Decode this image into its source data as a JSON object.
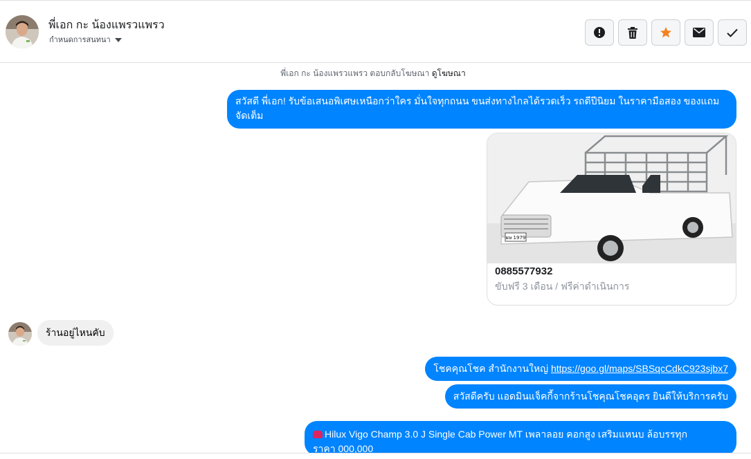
{
  "header": {
    "contact_name": "พี่เอก กะ น้องแพรวแพรว",
    "assign_label": "กำหนดการสนทนา",
    "actions": [
      {
        "name": "report-button",
        "icon": "alert-circle-icon"
      },
      {
        "name": "delete-button",
        "icon": "trash-icon"
      },
      {
        "name": "star-button",
        "icon": "star-icon"
      },
      {
        "name": "mark-unread-button",
        "icon": "envelope-icon"
      },
      {
        "name": "mark-done-button",
        "icon": "check-icon"
      }
    ]
  },
  "system_note": {
    "text": "พี่เอก กะ น้องแพรวแพรว ตอบกลับโฆษณา",
    "link": "ดูโฆษณา"
  },
  "messages": {
    "ad_reply": "สวัสดี พี่เอก! รับข้อเสนอพิเศษเหนือกว่าใคร มั่นใจทุกถนน ขนส่งทางไกลได้รวดเร็ว รถดีปีนิยม ในราคามือสอง ของแถมจัดเต็ม",
    "card": {
      "title": "0885577932",
      "subtitle": "ขับฟรี 3 เดือน / ฟรีค่าดำเนินการ",
      "plate": "ผษ 1979"
    },
    "customer_reply": "ร้านอยู่ไหนคับ",
    "location_prefix": "โชคคุณโชค สำนักงานใหญ่ ",
    "location_link": "https://goo.gl/maps/SBSqcCdkC923sjbx7",
    "greeting": "สวัสดีครับ แอดมินแจ็คกี้จากร้านโชคุณโชคอุดร ยินดีให้บริการครับ",
    "vehicle_info": "Hilux Vigo Champ 3.0 J Single Cab Power MT เพลาลอย คอกสูง เสริมแหนบ ล้อบรรทุก",
    "vehicle_info_cont": "ราคา 000,000"
  },
  "colors": {
    "outgoing_bubble": "#0084ff",
    "incoming_bubble": "#f0f0f0",
    "star": "#f5821f"
  }
}
